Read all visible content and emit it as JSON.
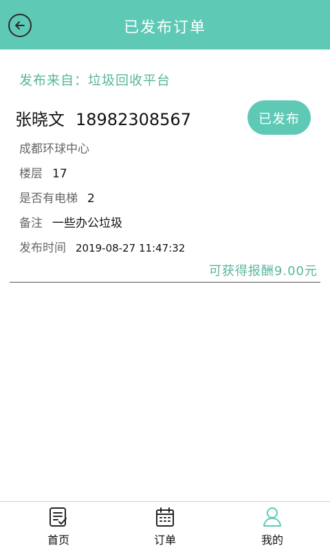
{
  "header": {
    "title": "已发布订单"
  },
  "order": {
    "source": "发布来自：垃圾回收平台",
    "name": "张晓文",
    "phone": "18982308567",
    "status_label": "已发布",
    "address": "成都环球中心",
    "floor_label": "楼层",
    "floor_value": "17",
    "elevator_label": "是否有电梯",
    "elevator_value": "2",
    "note_label": "备注",
    "note_value": "一些办公垃圾",
    "time_label": "发布时间",
    "time_value": "2019-08-27 11:47:32",
    "reward": "可获得报酬9.00元"
  },
  "tabbar": {
    "items": [
      {
        "label": "首页",
        "icon": "document-icon"
      },
      {
        "label": "订单",
        "icon": "calendar-icon"
      },
      {
        "label": "我的",
        "icon": "user-icon"
      }
    ]
  },
  "colors": {
    "accent": "#5ec9b5",
    "accent_text": "#58b59d"
  }
}
